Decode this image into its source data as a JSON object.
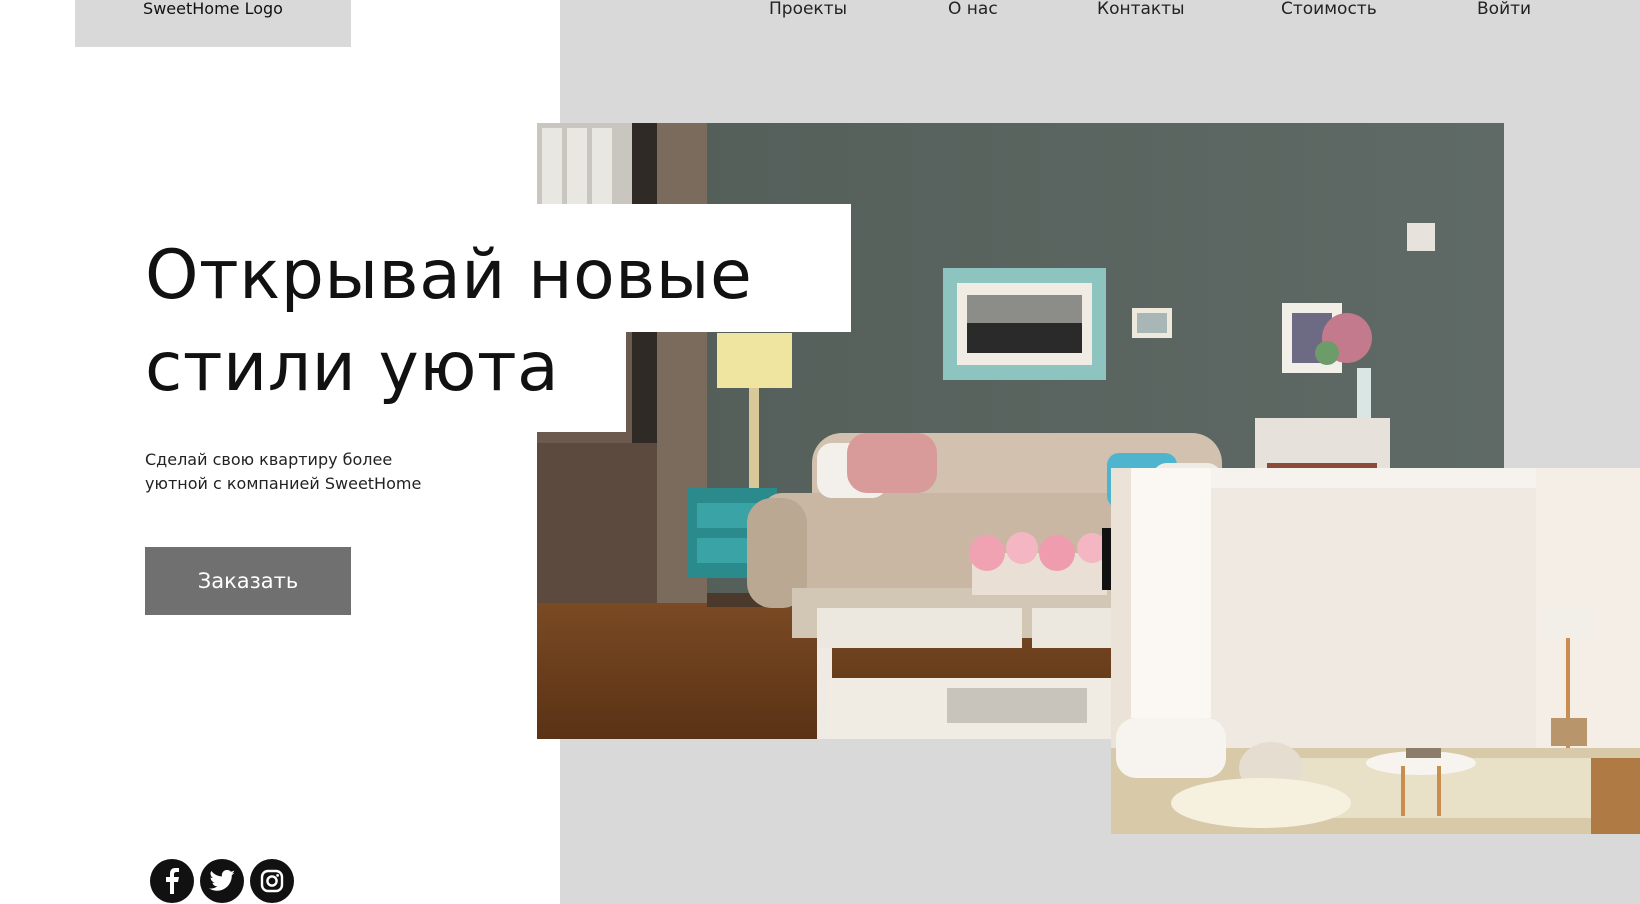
{
  "header": {
    "logo_text": "SweetHome Logo",
    "nav": [
      {
        "label": "Проекты"
      },
      {
        "label": "О нас"
      },
      {
        "label": "Контакты"
      },
      {
        "label": "Стоимость"
      },
      {
        "label": "Войти"
      }
    ]
  },
  "hero": {
    "title_line1": "Открывай новые",
    "title_line2": "стили уюта",
    "subtitle_line1": "Сделай свою квартиру более",
    "subtitle_line2": "уютной с компанией SweetHome",
    "cta_label": "Заказать"
  },
  "social": [
    {
      "icon": "facebook-icon"
    },
    {
      "icon": "twitter-icon"
    },
    {
      "icon": "instagram-icon"
    }
  ],
  "colors": {
    "panel_gray": "#d9d9d9",
    "button_gray": "#707070",
    "text": "#111111"
  }
}
